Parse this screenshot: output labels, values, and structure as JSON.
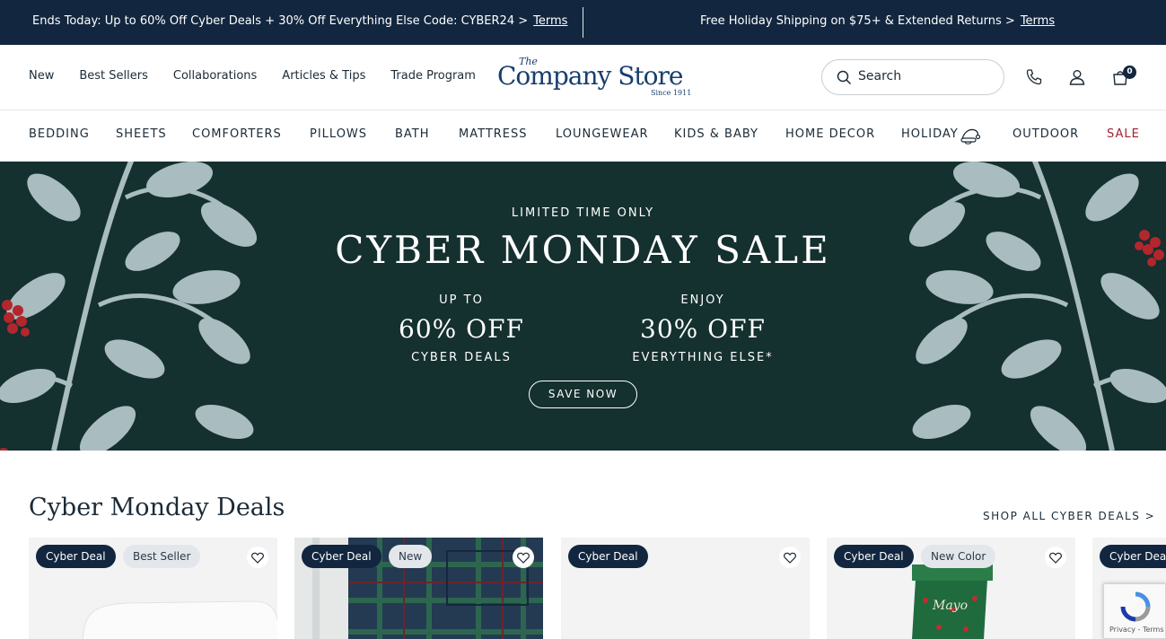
{
  "promo": {
    "left_text": "Ends Today: Up to 60% Off Cyber Deals + 30% Off Everything Else Code: CYBER24 >",
    "left_link": "Terms",
    "right_text": "Free Holiday Shipping on $75+ & Extended Returns >",
    "right_link": "Terms"
  },
  "header": {
    "util_nav": [
      "New",
      "Best Sellers",
      "Collaborations",
      "Articles & Tips",
      "Trade Program"
    ],
    "logo": {
      "the": "The",
      "name": "Company Store",
      "since": "Since 1911"
    },
    "search_placeholder": "Search",
    "cart_count": "0",
    "icons": [
      "search-icon",
      "phone-icon",
      "account-icon",
      "cart-icon"
    ]
  },
  "categories": [
    "BEDDING",
    "SHEETS",
    "COMFORTERS",
    "PILLOWS",
    "BATH",
    "MATTRESS",
    "LOUNGEWEAR",
    "KIDS & BABY",
    "HOME DECOR",
    "HOLIDAY",
    "OUTDOOR",
    "SALE"
  ],
  "hero": {
    "kicker": "LIMITED TIME ONLY",
    "title": "CYBER MONDAY SALE",
    "offer1": {
      "top": "UP TO",
      "big": "60% OFF",
      "bottom": "CYBER DEALS"
    },
    "offer2": {
      "top": "ENJOY",
      "big": "30% OFF",
      "bottom": "EVERYTHING ELSE*"
    },
    "button": "SAVE NOW"
  },
  "deals": {
    "title": "Cyber Monday Deals",
    "shop_all": "SHOP ALL CYBER DEALS >",
    "cards": [
      {
        "badges": [
          "Cyber Deal",
          "Best Seller"
        ]
      },
      {
        "badges": [
          "Cyber Deal",
          "New"
        ]
      },
      {
        "badges": [
          "Cyber Deal"
        ]
      },
      {
        "badges": [
          "Cyber Deal",
          "New Color"
        ]
      },
      {
        "badges": [
          "Cyber Deal"
        ]
      }
    ]
  },
  "colors": {
    "navy": "#12263f",
    "hero_bg": "#14302f",
    "leaf": "#a9bcbf",
    "berry": "#b3262d",
    "sale_red": "#a0232f"
  },
  "recaptcha": {
    "text": "Privacy - Terms"
  }
}
